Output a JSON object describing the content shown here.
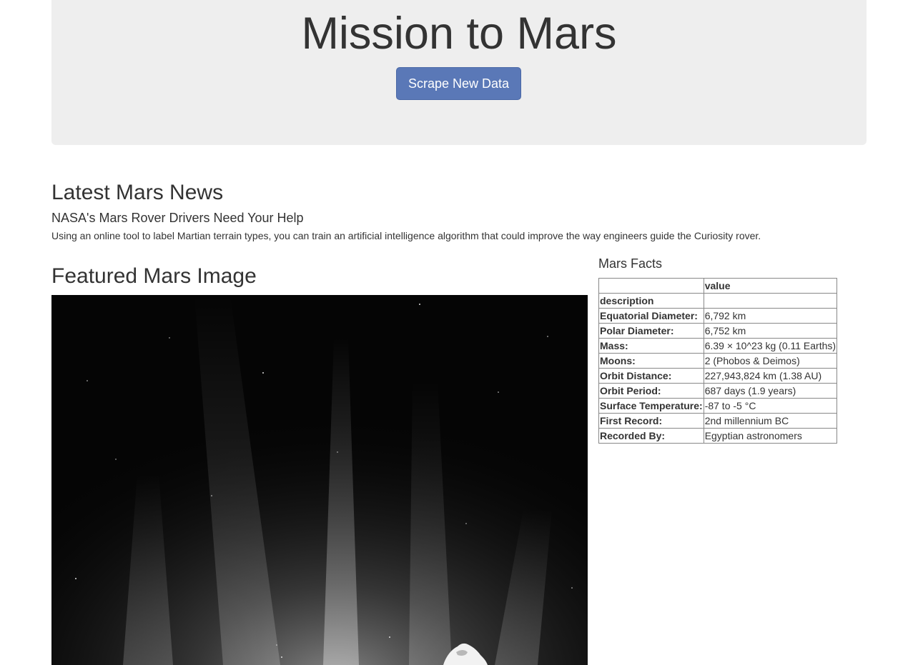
{
  "header": {
    "title": "Mission to Mars",
    "scrape_button_label": "Scrape New Data"
  },
  "news": {
    "heading": "Latest Mars News",
    "title": "NASA's Mars Rover Drivers Need Your Help",
    "paragraph": "Using an online tool to label Martian terrain types, you can train an artificial intelligence algorithm that could improve the way engineers guide the Curiosity rover."
  },
  "featured": {
    "heading": "Featured Mars Image",
    "image_icon": "space-photo"
  },
  "facts": {
    "heading": "Mars Facts",
    "column_header": "value",
    "rows": [
      {
        "label": "description",
        "value": ""
      },
      {
        "label": "Equatorial Diameter:",
        "value": "6,792 km"
      },
      {
        "label": "Polar Diameter:",
        "value": "6,752 km"
      },
      {
        "label": "Mass:",
        "value": "6.39 × 10^23 kg (0.11 Earths)"
      },
      {
        "label": "Moons:",
        "value": "2 (Phobos & Deimos)"
      },
      {
        "label": "Orbit Distance:",
        "value": "227,943,824 km (1.38 AU)"
      },
      {
        "label": "Orbit Period:",
        "value": "687 days (1.9 years)"
      },
      {
        "label": "Surface Temperature:",
        "value": "-87 to -5 °C"
      },
      {
        "label": "First Record:",
        "value": "2nd millennium BC"
      },
      {
        "label": "Recorded By:",
        "value": "Egyptian astronomers"
      }
    ]
  },
  "colors": {
    "jumbotron_bg": "#eeeeee",
    "button_bg": "#5a78b7",
    "text": "#333333"
  }
}
